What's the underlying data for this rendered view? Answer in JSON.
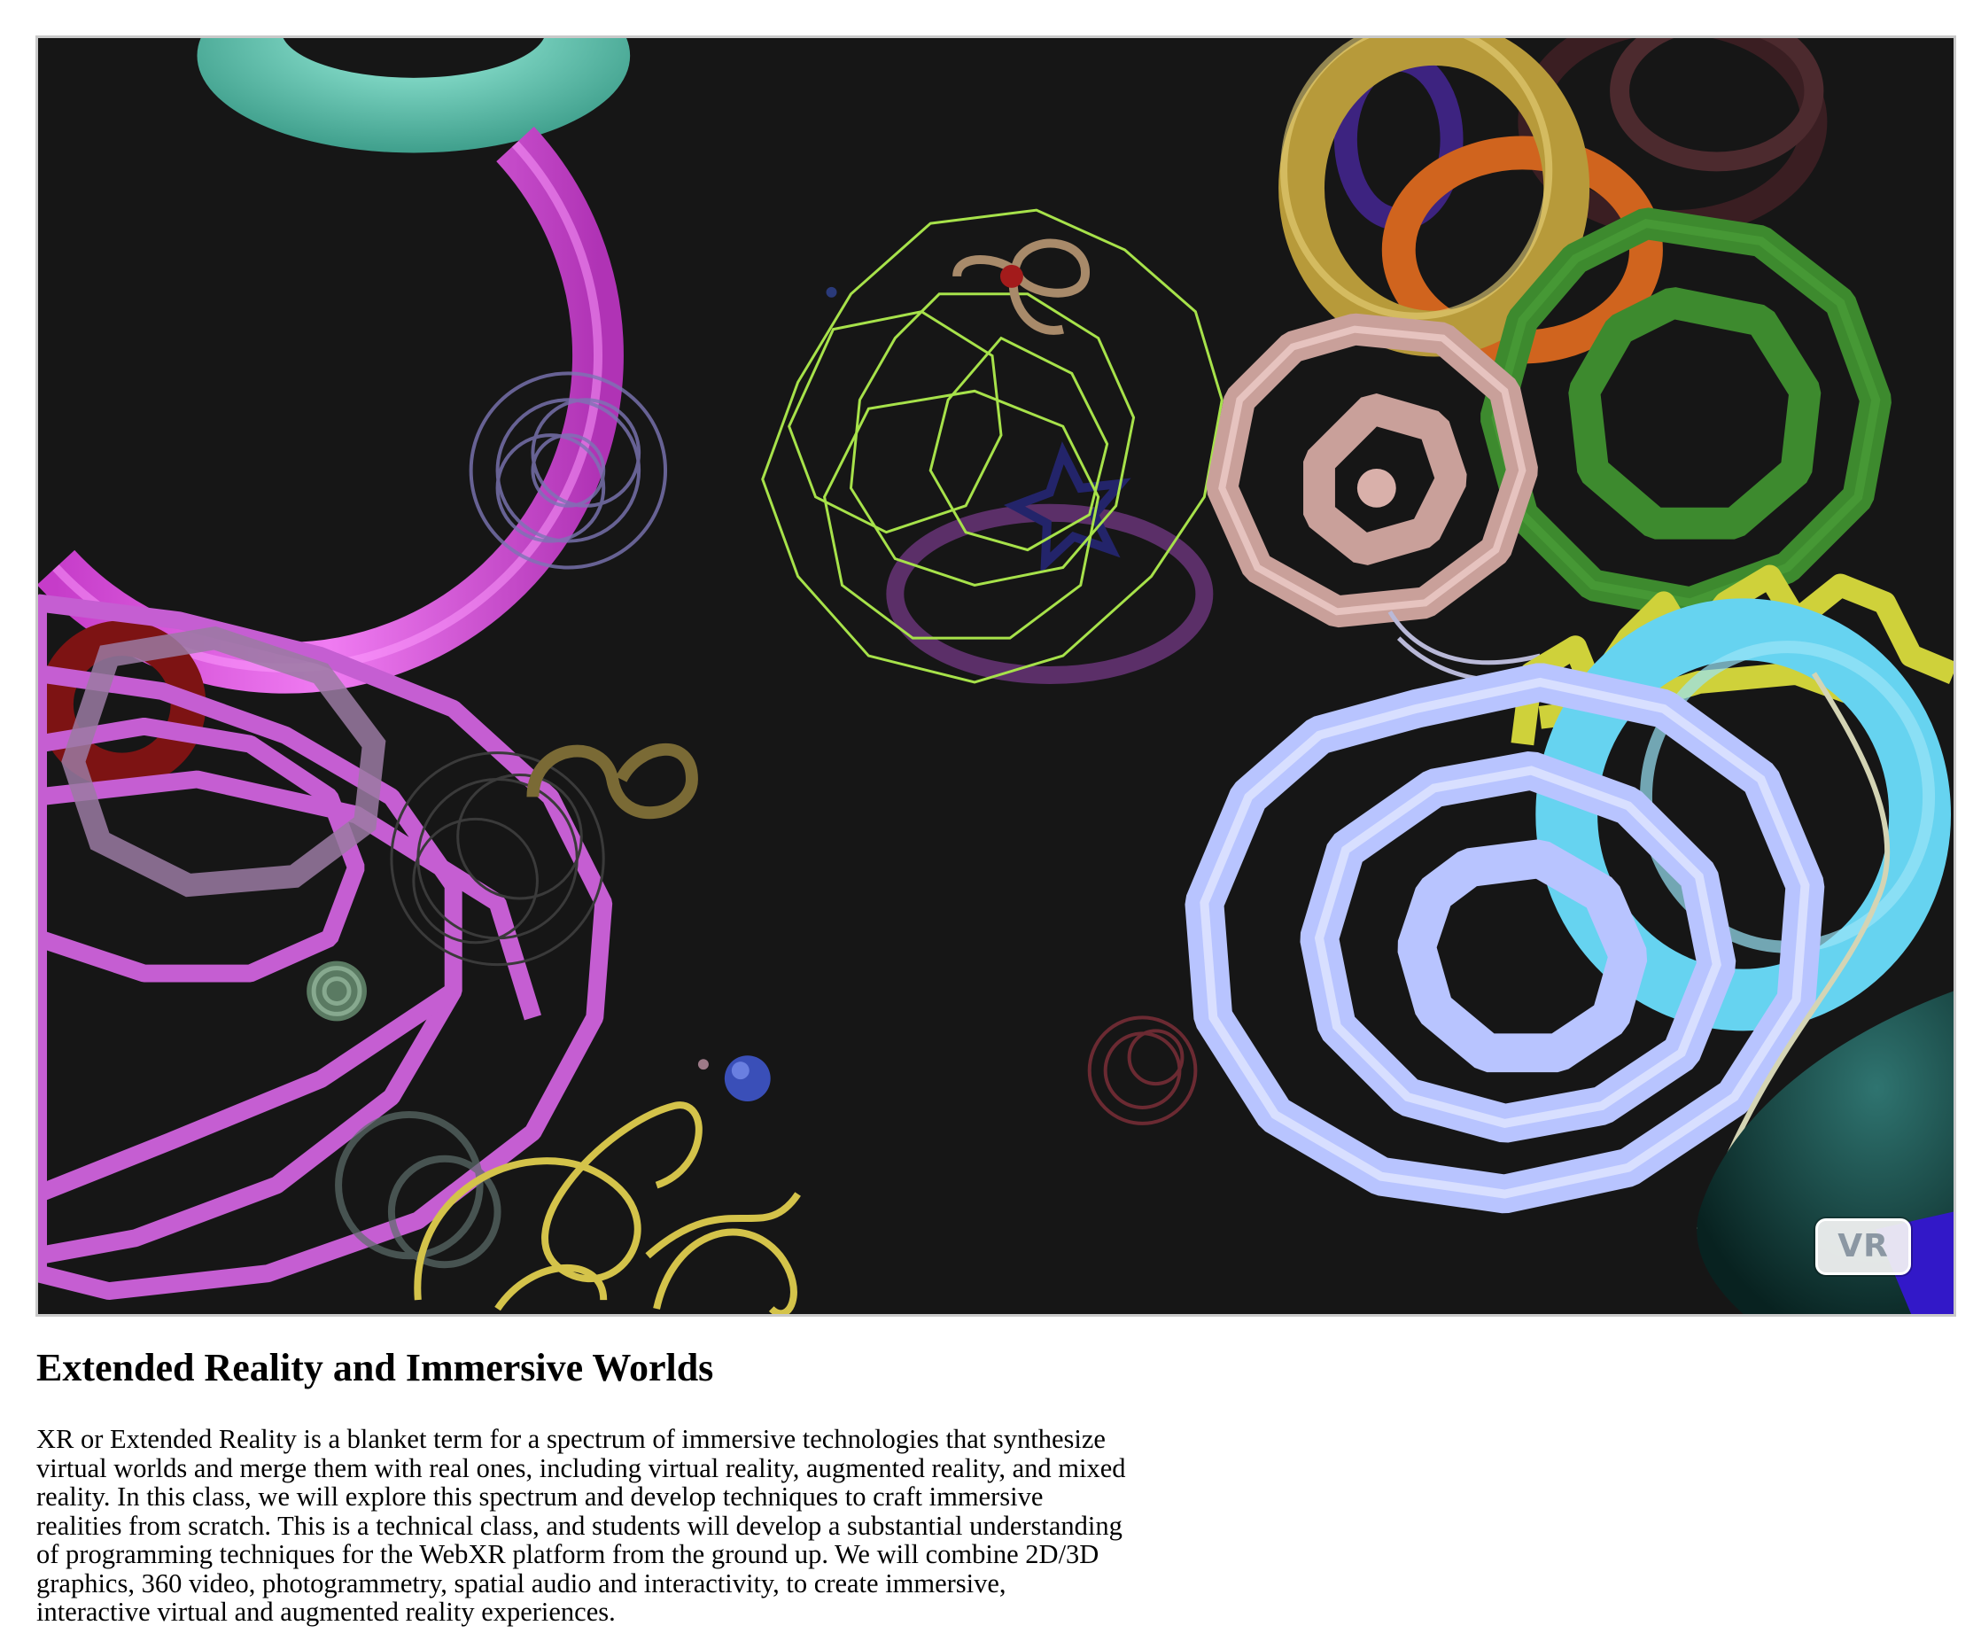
{
  "viewer": {
    "vr_button_label": "VR",
    "background_color": "#161616"
  },
  "content": {
    "title": "Extended Reality and Immersive Worlds",
    "description": "XR or Extended Reality is a blanket term for a spectrum of immersive technologies that synthesize virtual worlds and merge them with real ones, including virtual reality, augmented reality, and mixed reality. In this class, we will explore this spectrum and develop techniques to craft immersive realities from scratch. This is a technical class, and students will develop a substantial understanding of programming techniques for the WebXR platform from the ground up. We will combine 2D/3D graphics, 360 video, photogrammetry, spatial audio and interactivity, to create immersive, interactive virtual and augmented reality experiences."
  },
  "scene_objects": [
    {
      "name": "teal-torus",
      "color": "#6fd9c4"
    },
    {
      "name": "magenta-ring",
      "color": "#e34ee6"
    },
    {
      "name": "violet-torus-knot",
      "color": "#c45cd0"
    },
    {
      "name": "lime-wireframe-knot",
      "color": "#a7e24a"
    },
    {
      "name": "gold-torus",
      "color": "#b79a3a"
    },
    {
      "name": "pink-spiral-knot",
      "color": "#c9a09a"
    },
    {
      "name": "green-spiral-knot",
      "color": "#3d8a2e"
    },
    {
      "name": "orange-torus",
      "color": "#d0641e"
    },
    {
      "name": "periwinkle-spiral-knot",
      "color": "#b8c4ff"
    },
    {
      "name": "cyan-torus",
      "color": "#66d3f0"
    },
    {
      "name": "yellow-torus-knot",
      "color": "#d8d83a"
    },
    {
      "name": "gold-wire-knot",
      "color": "#d4c34a"
    }
  ]
}
